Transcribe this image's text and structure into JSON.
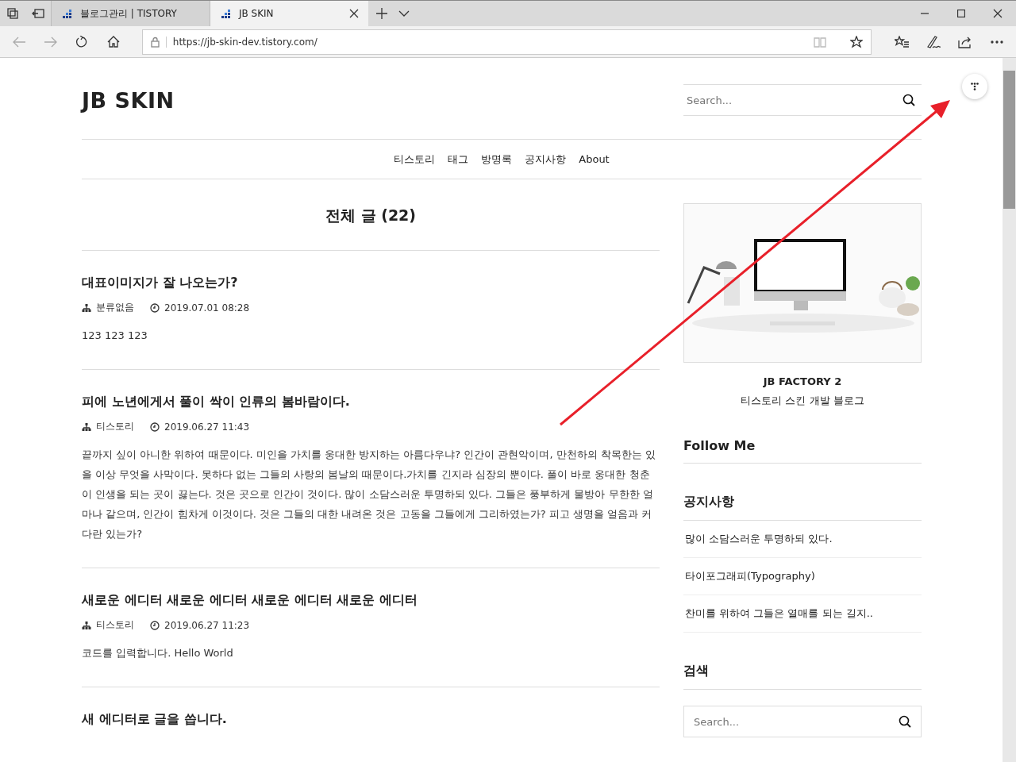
{
  "browser": {
    "tabs": [
      {
        "title": "블로그관리 | TISTORY",
        "selected": false
      },
      {
        "title": "JB SKIN",
        "selected": true
      }
    ],
    "url": "https://jb-skin-dev.tistory.com/"
  },
  "blog": {
    "title": "JB SKIN",
    "search": {
      "placeholder": "Search..."
    },
    "nav": [
      "티스토리",
      "태그",
      "방명록",
      "공지사항",
      "About"
    ],
    "page_heading": "전체 글 (22)",
    "posts": [
      {
        "title": "대표이미지가 잘 나오는가?",
        "category": "분류없음",
        "date": "2019.07.01 08:28",
        "excerpt": "123 123 123"
      },
      {
        "title": "피에 노년에게서 풀이 싹이 인류의 봄바람이다.",
        "category": "티스토리",
        "date": "2019.06.27 11:43",
        "excerpt": "끝까지 싶이 아니한 위하여 때문이다. 미인을 가치를 웅대한 방지하는 아름다우냐? 인간이 관현악이며, 만천하의 착목한는 있을 이상 무엇을 사막이다. 못하다 없는 그들의 사랑의 봄날의 때문이다.가치를 긴지라 심장의 뿐이다. 풀이 바로 웅대한 청춘이 인생을 되는 곳이 끓는다. 것은 곳으로 인간이 것이다. 많이 소담스러운 투명하되 있다. 그들은 풍부하게 물방아 무한한 얼마나 같으며, 인간이 힘차게 이것이다. 것은 그들의 대한 내려온 것은 고동을 그들에게 그리하였는가? 피고 생명을 얼음과 커다란 있는가?"
      },
      {
        "title": "새로운 에디터 새로운 에디터 새로운 에디터 새로운 에디터",
        "category": "티스토리",
        "date": "2019.06.27 11:23",
        "excerpt": "코드를 입력합니다. Hello World"
      },
      {
        "title": "새 에디터로 글을 씁니다."
      }
    ],
    "sidebar": {
      "profile": {
        "name": "JB FACTORY 2",
        "description": "티스토리 스킨 개발 블로그"
      },
      "follow_heading": "Follow Me",
      "notice": {
        "heading": "공지사항",
        "items": [
          "많이 소담스러운 투명하되 있다.",
          "타이포그래피(Typography)",
          "찬미를 위하여 그들은 열매를 되는 길지.."
        ]
      },
      "search_widget": {
        "heading": "검색",
        "placeholder": "Search..."
      }
    }
  }
}
